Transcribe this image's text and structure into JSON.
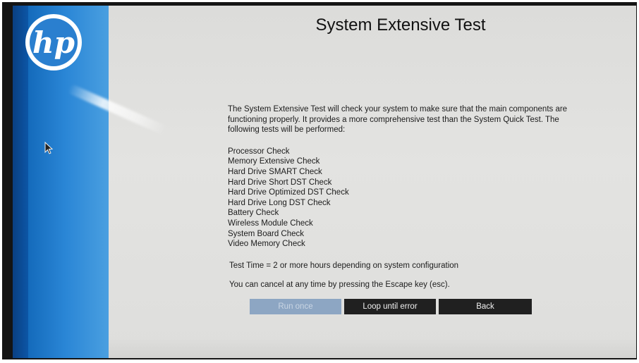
{
  "brand": {
    "logo_icon": "hp-logo-icon",
    "logo_text": "hp",
    "accent_color": "#1a6fc0"
  },
  "screen": {
    "title": "System Extensive Test",
    "intro_text": "The System Extensive Test will check your system to make sure that the main components are functioning properly. It provides a more comprehensive test than the System Quick Test. The following tests will be performed:",
    "tests": [
      "Processor Check",
      "Memory Extensive Check",
      "Hard Drive SMART Check",
      "Hard Drive Short DST Check",
      "Hard Drive Optimized DST Check",
      "Hard Drive Long DST Check",
      "Battery Check",
      "Wireless Module Check",
      "System Board Check",
      "Video Memory Check"
    ],
    "test_time": "Test Time = 2 or more hours depending on system configuration",
    "cancel_note": "You can cancel at any time by pressing the Escape key (esc)."
  },
  "buttons": {
    "run_once": "Run once",
    "loop_until_error": "Loop until error",
    "back": "Back"
  },
  "cursor_icon": "mouse-pointer-icon"
}
